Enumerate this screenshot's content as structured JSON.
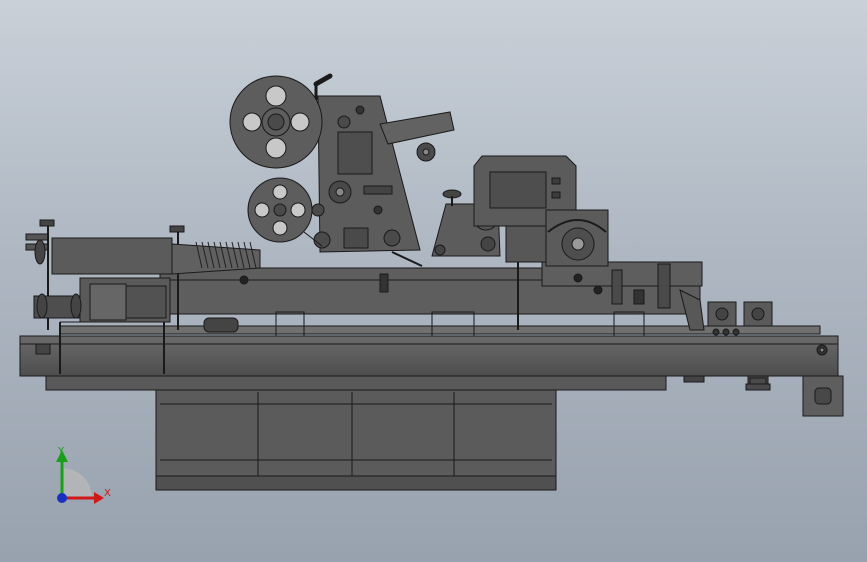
{
  "viewport": {
    "background_top": "#c9d0d8",
    "background_bottom": "#98a2ae",
    "model_color": "#5b5b5b",
    "edge_color": "#1a1a1a"
  },
  "triad": {
    "x_label": "X",
    "y_label": "Y",
    "x_color": "#d01818",
    "y_color": "#18a018",
    "z_color": "#1830c0"
  },
  "machine_parts": [
    "label-roll-large",
    "label-roll-small",
    "labeling-head",
    "control-screen",
    "spring-conveyor",
    "drive-motor",
    "main-frame",
    "conveyor-bed",
    "cabinet-base",
    "output-rollers",
    "side-bracket"
  ]
}
